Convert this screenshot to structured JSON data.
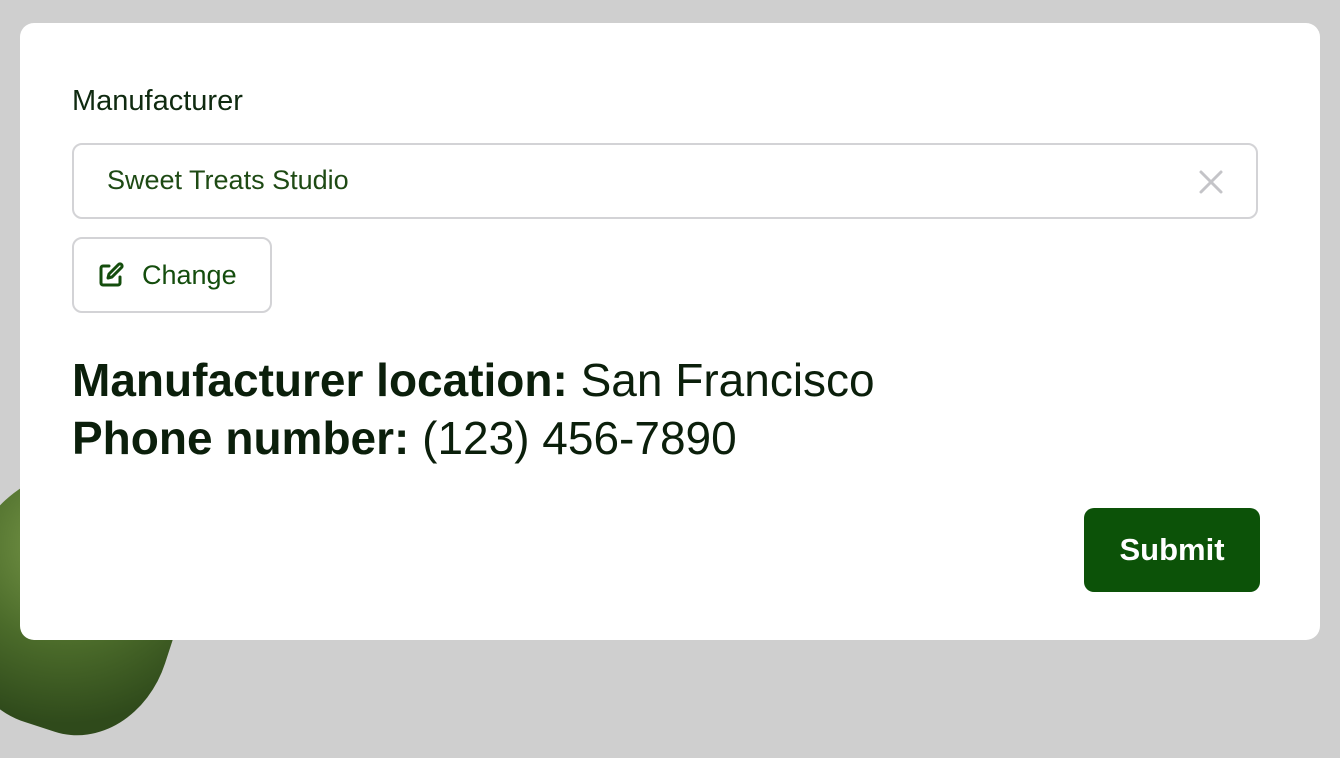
{
  "form": {
    "manufacturer_label": "Manufacturer",
    "manufacturer_value": "Sweet Treats Studio",
    "clear_icon": "close-icon",
    "change_icon": "edit-icon",
    "change_label": "Change",
    "location_key": "Manufacturer location:",
    "location_value": "San Francisco",
    "phone_key": "Phone number:",
    "phone_value": "(123) 456-7890",
    "submit_label": "Submit"
  },
  "colors": {
    "accent": "#0c5208",
    "text_dark": "#0b1f0b",
    "border": "#d3d3d6",
    "backdrop": "#cfcfcf"
  }
}
